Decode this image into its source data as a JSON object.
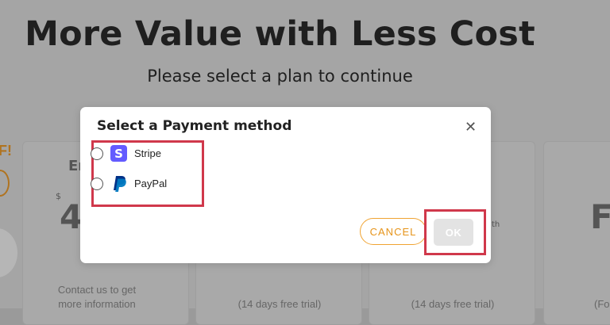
{
  "hero": {
    "title": "More Value with Less Cost",
    "subtitle": "Please select a plan to continue"
  },
  "background": {
    "left_badge_fragment": "F!",
    "card1_title_fragment": "Er",
    "card1_currency": "$",
    "card1_price_fragment": "4",
    "card1_footer": "Contact us to get more information",
    "card2_footer": "(14 days free trial)",
    "card3_footer": "(14 days free trial)",
    "card3_period_fragment": "th",
    "card4_price_fragment": "F",
    "card4_footer_fragment": "(Fo"
  },
  "modal": {
    "title": "Select a Payment method",
    "close_icon": "close-icon",
    "options": [
      {
        "label": "Stripe",
        "icon": "stripe-logo-icon",
        "logo_letter": "S",
        "color": "#635bff"
      },
      {
        "label": "PayPal",
        "icon": "paypal-logo-icon",
        "color": "#003087"
      }
    ],
    "cancel_label": "CANCEL",
    "ok_label": "OK"
  },
  "colors": {
    "accent_orange": "#f0a331",
    "highlight_red": "#d0384b",
    "ok_disabled": "#e3e3e3"
  }
}
